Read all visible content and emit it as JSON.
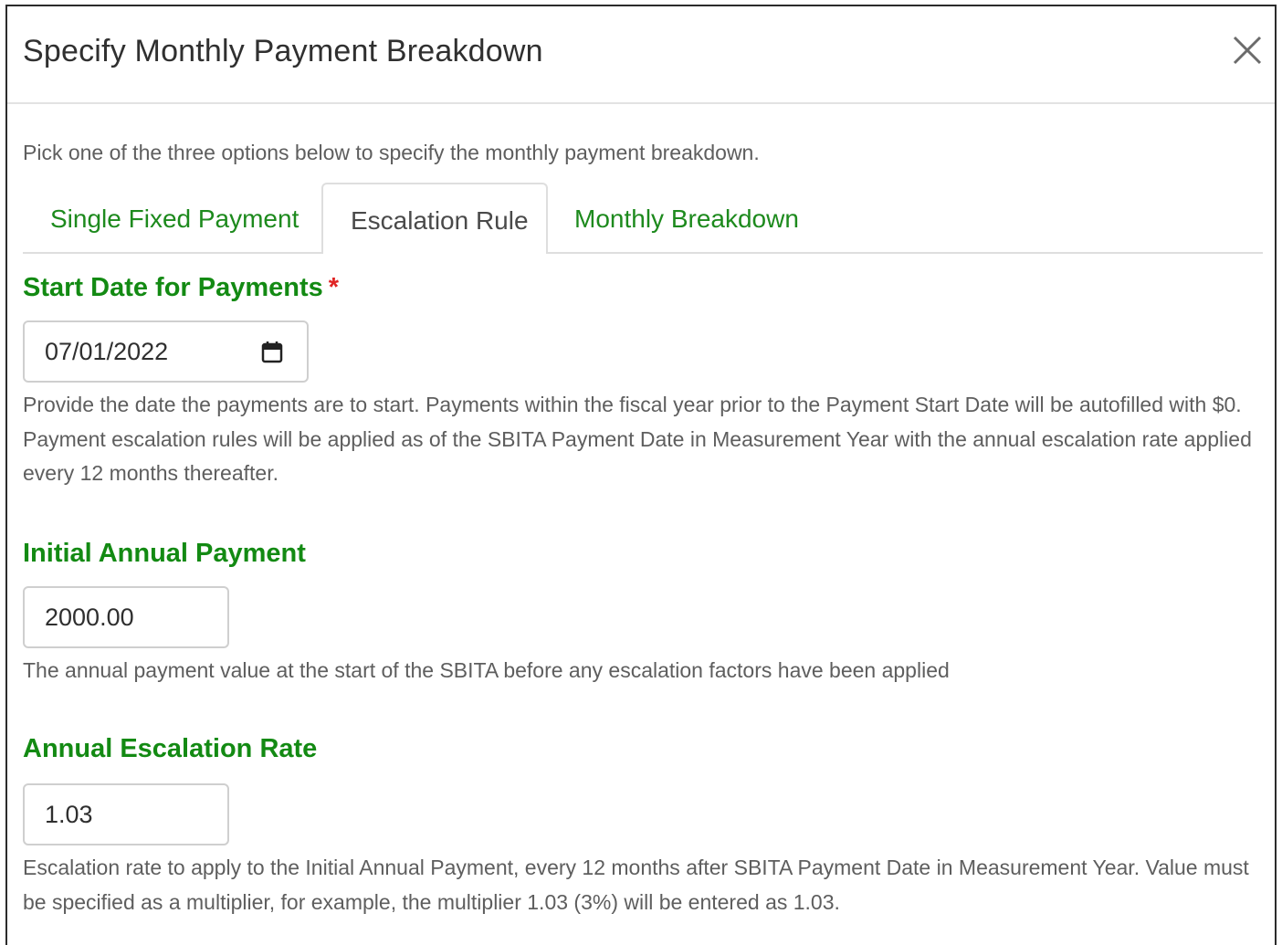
{
  "dialog": {
    "title": "Specify Monthly Payment Breakdown",
    "close_icon": "close-icon"
  },
  "intro": "Pick one of the three options below to specify the monthly payment breakdown.",
  "tabs": [
    {
      "label": "Single Fixed Payment",
      "active": false
    },
    {
      "label": "Escalation Rule",
      "active": true
    },
    {
      "label": "Monthly Breakdown",
      "active": false
    }
  ],
  "start_date": {
    "label": "Start Date for Payments",
    "required_marker": "*",
    "value": "07/01/2022",
    "icon": "calendar-icon",
    "help": "Provide the date the payments are to start. Payments within the fiscal year prior to the Payment Start Date will be autofilled with $0. Payment escalation rules will be applied as of the SBITA Payment Date in Measurement Year with the annual escalation rate applied every 12 months thereafter."
  },
  "initial_payment": {
    "label": "Initial Annual Payment",
    "value": "2000.00",
    "help": "The annual payment value at the start of the SBITA before any escalation factors have been applied"
  },
  "escalation_rate": {
    "label": "Annual Escalation Rate",
    "value": "1.03",
    "help": "Escalation rate to apply to the Initial Annual Payment, every 12 months after SBITA Payment Date in Measurement Year. Value must be specified as a multiplier, for example, the multiplier 1.03 (3%) will be entered as 1.03."
  },
  "colors": {
    "accent_green": "#138a13",
    "tab_green": "#1d8a1d",
    "required_red": "#e02424"
  }
}
